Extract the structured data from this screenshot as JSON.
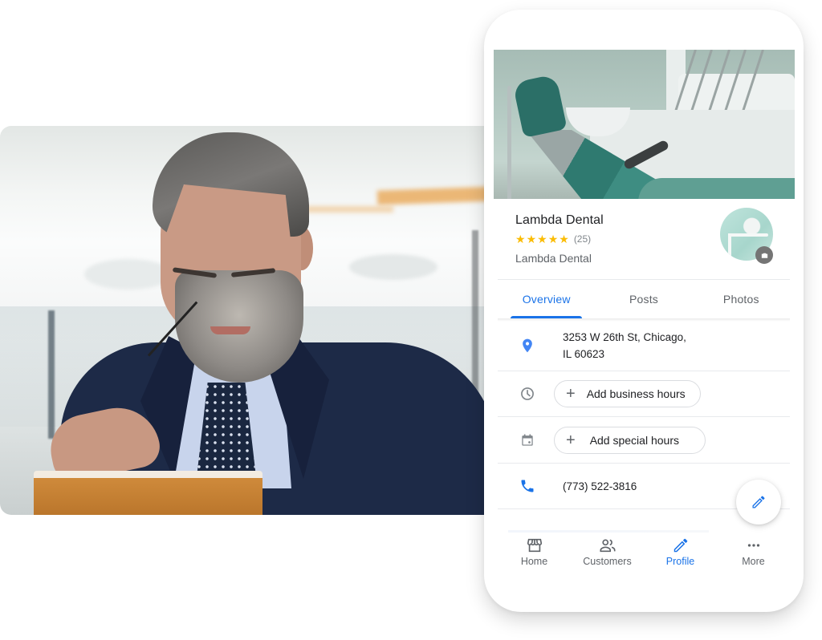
{
  "business": {
    "name": "Lambda Dental",
    "rating": 5,
    "rating_max": 5,
    "review_count": "(25)",
    "category": "Lambda Dental"
  },
  "tabs": [
    {
      "label": "Overview",
      "active": true
    },
    {
      "label": "Posts",
      "active": false
    },
    {
      "label": "Photos",
      "active": false
    }
  ],
  "details": {
    "address_line1": "3253 W 26th St, Chicago,",
    "address_line2": "IL 60623",
    "business_hours_action": "Add business hours",
    "special_hours_action": "Add special hours",
    "phone": "(773) 522-3816"
  },
  "icons": {
    "address": "location-pin-icon",
    "hours": "clock-icon",
    "special_hours": "calendar-icon",
    "phone": "phone-icon",
    "fab": "pencil-icon",
    "add": "plus-icon"
  },
  "bottom_nav": [
    {
      "label": "Home",
      "icon": "storefront-icon",
      "active": false
    },
    {
      "label": "Customers",
      "icon": "people-icon",
      "active": false
    },
    {
      "label": "Profile",
      "icon": "pencil-icon",
      "active": true
    },
    {
      "label": "More",
      "icon": "more-horizontal-icon",
      "active": false
    }
  ],
  "colors": {
    "accent": "#1a73e8",
    "star": "#fbbc04",
    "text_primary": "#202124",
    "text_secondary": "#5f6368",
    "icon_gray": "#757575"
  }
}
